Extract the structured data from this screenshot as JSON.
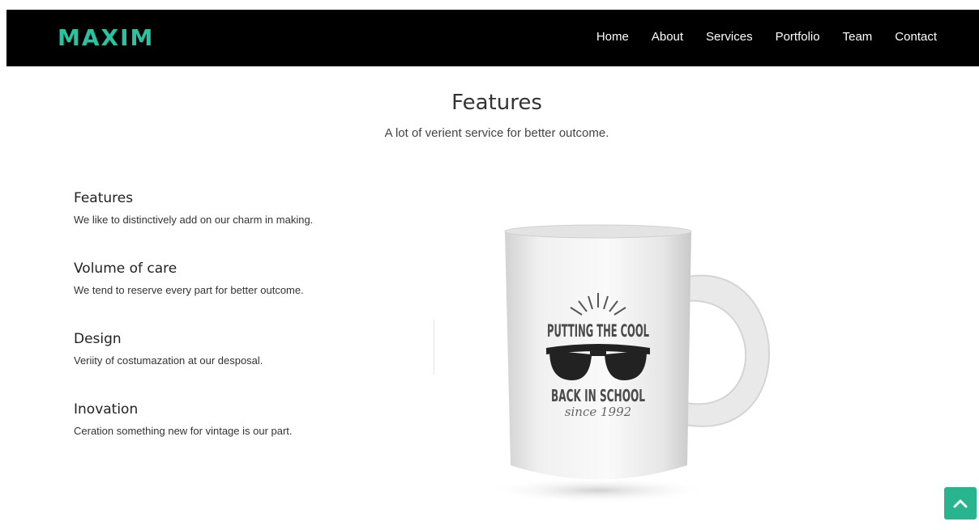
{
  "brand": "MAXIM",
  "nav": {
    "items": [
      {
        "label": "Home"
      },
      {
        "label": "About"
      },
      {
        "label": "Services"
      },
      {
        "label": "Portfolio"
      },
      {
        "label": "Team"
      },
      {
        "label": "Contact"
      }
    ]
  },
  "section": {
    "title": "Features",
    "subtitle": "A lot of verient service for better outcome."
  },
  "features": [
    {
      "title": "Features",
      "text": "We like to distinctively add on our charm in making."
    },
    {
      "title": "Volume of care",
      "text": "We tend to reserve every part for better outcome."
    },
    {
      "title": "Design",
      "text": "Veriity of costumazation at our desposal."
    },
    {
      "title": "Inovation",
      "text": "Ceration something new for vintage is our part."
    }
  ],
  "mug": {
    "line1": "PUTTING THE COOL",
    "line2": "BACK IN SCHOOL",
    "line3": "since 1992"
  },
  "colors": {
    "accent": "#28c3a0",
    "nav_bg": "#000000",
    "scroll_button": "#28b48f"
  },
  "icons": {
    "scroll_top": "chevron-up-icon"
  }
}
